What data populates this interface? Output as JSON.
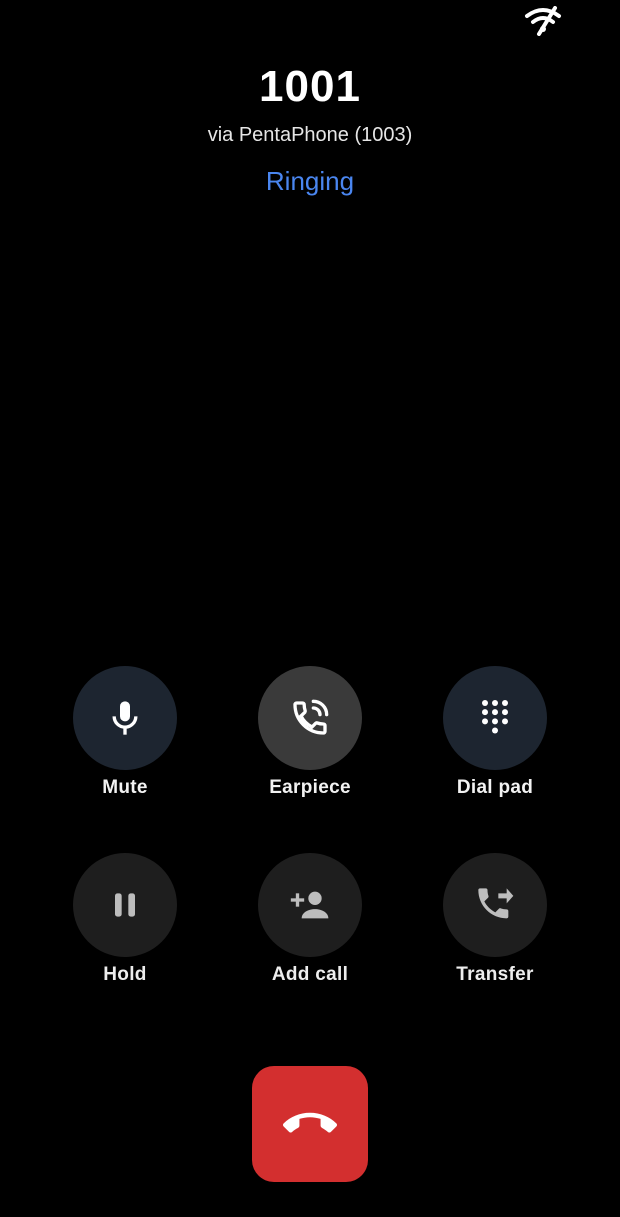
{
  "call": {
    "number": "1001",
    "via": "via PentaPhone (1003)",
    "state": "Ringing",
    "state_color": "#4a86f0"
  },
  "controls": [
    {
      "label": "Mute",
      "icon": "microphone-icon"
    },
    {
      "label": "Earpiece",
      "icon": "earpiece-icon"
    },
    {
      "label": "Dial pad",
      "icon": "dialpad-icon"
    },
    {
      "label": "Hold",
      "icon": "pause-icon"
    },
    {
      "label": "Add call",
      "icon": "add-person-icon"
    },
    {
      "label": "Transfer",
      "icon": "transfer-icon"
    }
  ],
  "end_call": {
    "icon": "end-call-icon",
    "color": "#d32f2f"
  },
  "status_bar": {
    "icon": "wifi-off-icon"
  }
}
